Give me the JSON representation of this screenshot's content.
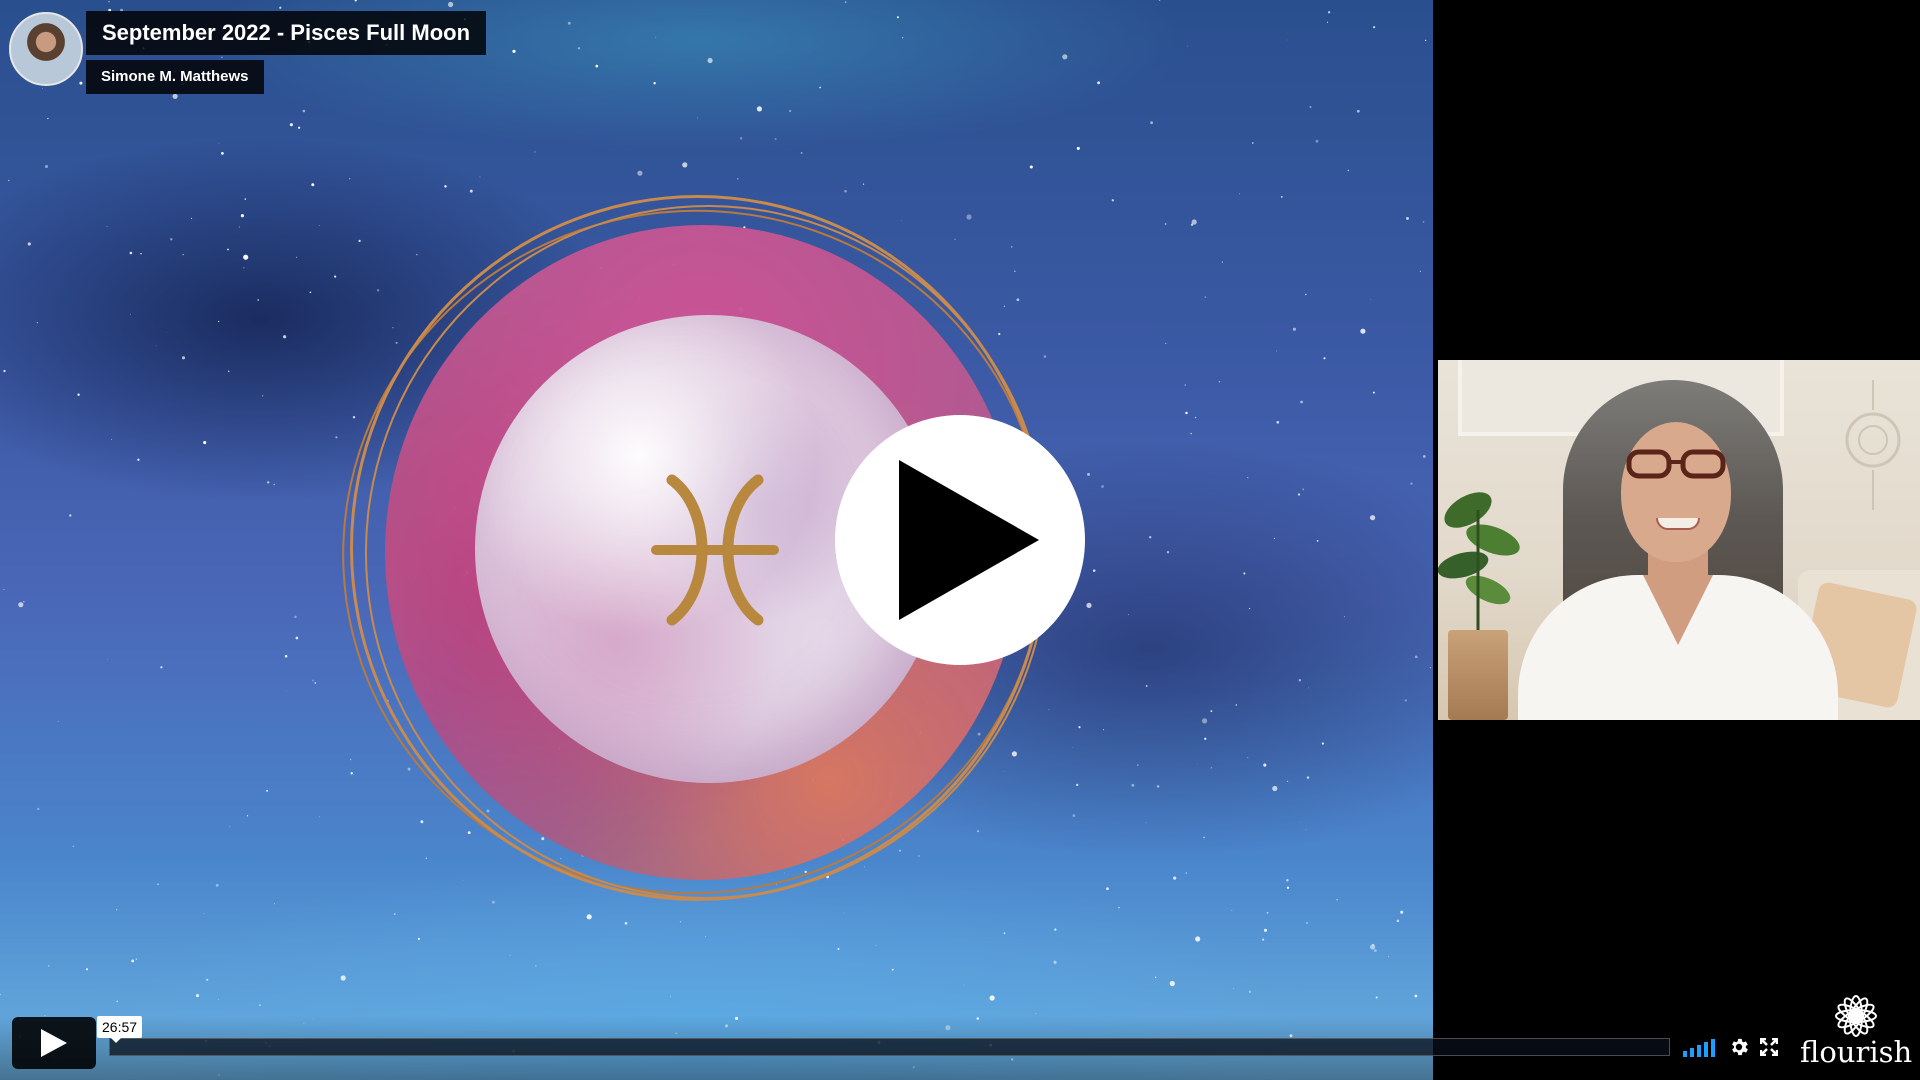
{
  "video": {
    "title": "September 2022 - Pisces Full Moon",
    "author": "Simone M. Matthews"
  },
  "player": {
    "current_time": "26:57",
    "progress_fraction": 0.0,
    "state": "paused"
  },
  "brand": {
    "logo_text": "flourish"
  },
  "icons": {
    "big_play": "play-icon",
    "play": "play-icon",
    "volume": "volume-bars-icon",
    "settings": "gear-icon",
    "fullscreen": "fullscreen-icon",
    "logo": "lotus-icon",
    "slide_symbol": "pisces-symbol"
  },
  "colors": {
    "accent_volume": "#1aa1ff",
    "ring_gold": "#c88a4e",
    "symbol_gold": "#b9883f",
    "overlay_black": "#000000"
  }
}
